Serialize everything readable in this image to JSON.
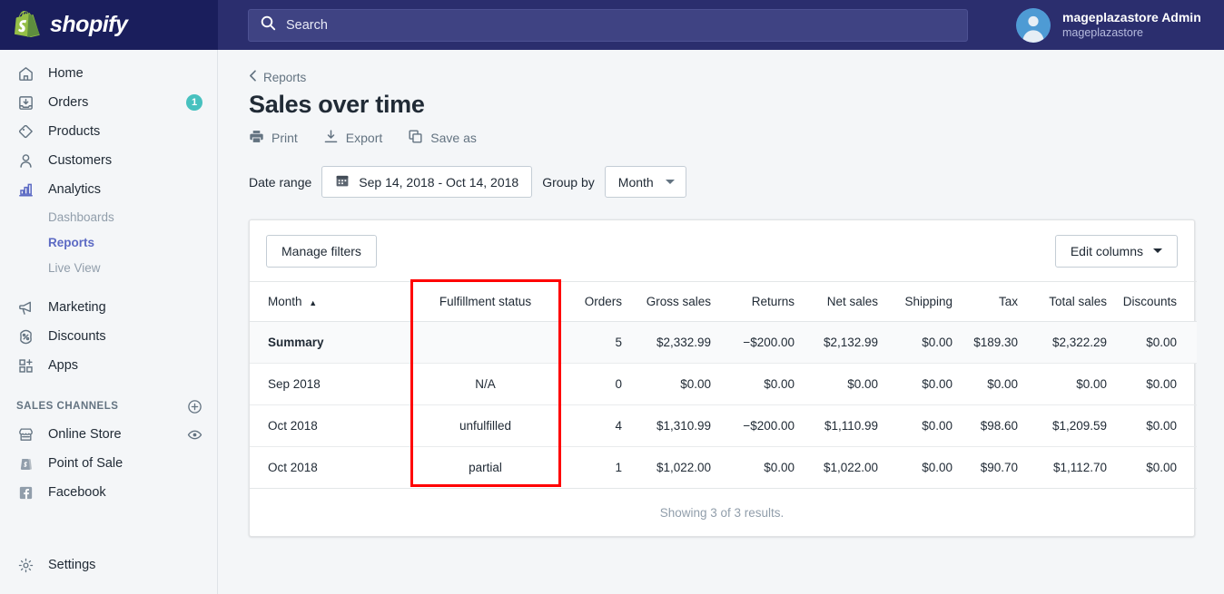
{
  "topbar": {
    "brand_name": "shopify",
    "brand_logo_icon": "shopify-bag-logo",
    "search": {
      "icon": "search-icon",
      "placeholder": "Search",
      "value": ""
    },
    "account": {
      "avatar_icon": "user-avatar-icon",
      "name": "mageplazastore Admin",
      "store": "mageplazastore"
    }
  },
  "sidebar": {
    "items": [
      {
        "label": "Home",
        "icon": "home-icon",
        "badge": ""
      },
      {
        "label": "Orders",
        "icon": "orders-inbox-icon",
        "badge": "1"
      },
      {
        "label": "Products",
        "icon": "products-tag-icon",
        "badge": ""
      },
      {
        "label": "Customers",
        "icon": "customers-person-icon",
        "badge": ""
      },
      {
        "label": "Analytics",
        "icon": "analytics-bar-chart-icon",
        "badge": ""
      }
    ],
    "analytics_subitems": [
      {
        "label": "Dashboards",
        "active": false
      },
      {
        "label": "Reports",
        "active": true
      },
      {
        "label": "Live View",
        "active": false
      }
    ],
    "items2": [
      {
        "label": "Marketing",
        "icon": "marketing-megaphone-icon",
        "badge": ""
      },
      {
        "label": "Discounts",
        "icon": "discounts-percent-icon",
        "badge": ""
      },
      {
        "label": "Apps",
        "icon": "apps-grid-plus-icon",
        "badge": ""
      }
    ],
    "sales_channels": {
      "heading": "SALES CHANNELS",
      "add_icon": "plus-circle-icon",
      "items": [
        {
          "label": "Online Store",
          "icon": "online-store-icon",
          "trailing_icon": "eye-icon"
        },
        {
          "label": "Point of Sale",
          "icon": "point-of-sale-icon",
          "trailing_icon": ""
        },
        {
          "label": "Facebook",
          "icon": "facebook-icon",
          "trailing_icon": ""
        }
      ]
    },
    "settings": {
      "label": "Settings",
      "icon": "gear-icon"
    },
    "accent_color": "#5C6AC4",
    "badge_color": "#47C1BF"
  },
  "main": {
    "breadcrumb": {
      "label": "Reports",
      "icon": "chevron-left-icon"
    },
    "page_title": "Sales over time",
    "actions": [
      {
        "label": "Print",
        "icon": "printer-icon"
      },
      {
        "label": "Export",
        "icon": "download-icon"
      },
      {
        "label": "Save as",
        "icon": "copy-icon"
      }
    ],
    "filters": {
      "date_range_label": "Date range",
      "date_range_value": "Sep 14, 2018 - Oct 14, 2018",
      "date_range_icon": "calendar-icon",
      "group_by_label": "Group by",
      "group_by_value": "Month",
      "group_by_icon": "chevron-down-icon"
    },
    "card": {
      "manage_filters_label": "Manage filters",
      "edit_columns_label": "Edit columns",
      "edit_columns_icon": "chevron-down-icon",
      "footer_text": "Showing 3 of 3 results."
    }
  },
  "table": {
    "sort_column": "Month",
    "sort_indicator": "▲",
    "columns": [
      "Month",
      "Fulfillment status",
      "Orders",
      "Gross sales",
      "Returns",
      "Net sales",
      "Shipping",
      "Tax",
      "Total sales",
      "Discounts"
    ],
    "rows": [
      {
        "is_summary": true,
        "cells": [
          "Summary",
          "",
          "5",
          "$2,332.99",
          "−$200.00",
          "$2,132.99",
          "$0.00",
          "$189.30",
          "$2,322.29",
          "$0.00"
        ]
      },
      {
        "is_summary": false,
        "cells": [
          "Sep 2018",
          "N/A",
          "0",
          "$0.00",
          "$0.00",
          "$0.00",
          "$0.00",
          "$0.00",
          "$0.00",
          "$0.00"
        ]
      },
      {
        "is_summary": false,
        "cells": [
          "Oct 2018",
          "unfulfilled",
          "4",
          "$1,310.99",
          "−$200.00",
          "$1,110.99",
          "$0.00",
          "$98.60",
          "$1,209.59",
          "$0.00"
        ]
      },
      {
        "is_summary": false,
        "cells": [
          "Oct 2018",
          "partial",
          "1",
          "$1,022.00",
          "$0.00",
          "$1,022.00",
          "$0.00",
          "$90.70",
          "$1,112.70",
          "$0.00"
        ]
      }
    ]
  },
  "annotation": {
    "highlight_column": "Fulfillment status",
    "highlight_color": "#FF0000"
  }
}
